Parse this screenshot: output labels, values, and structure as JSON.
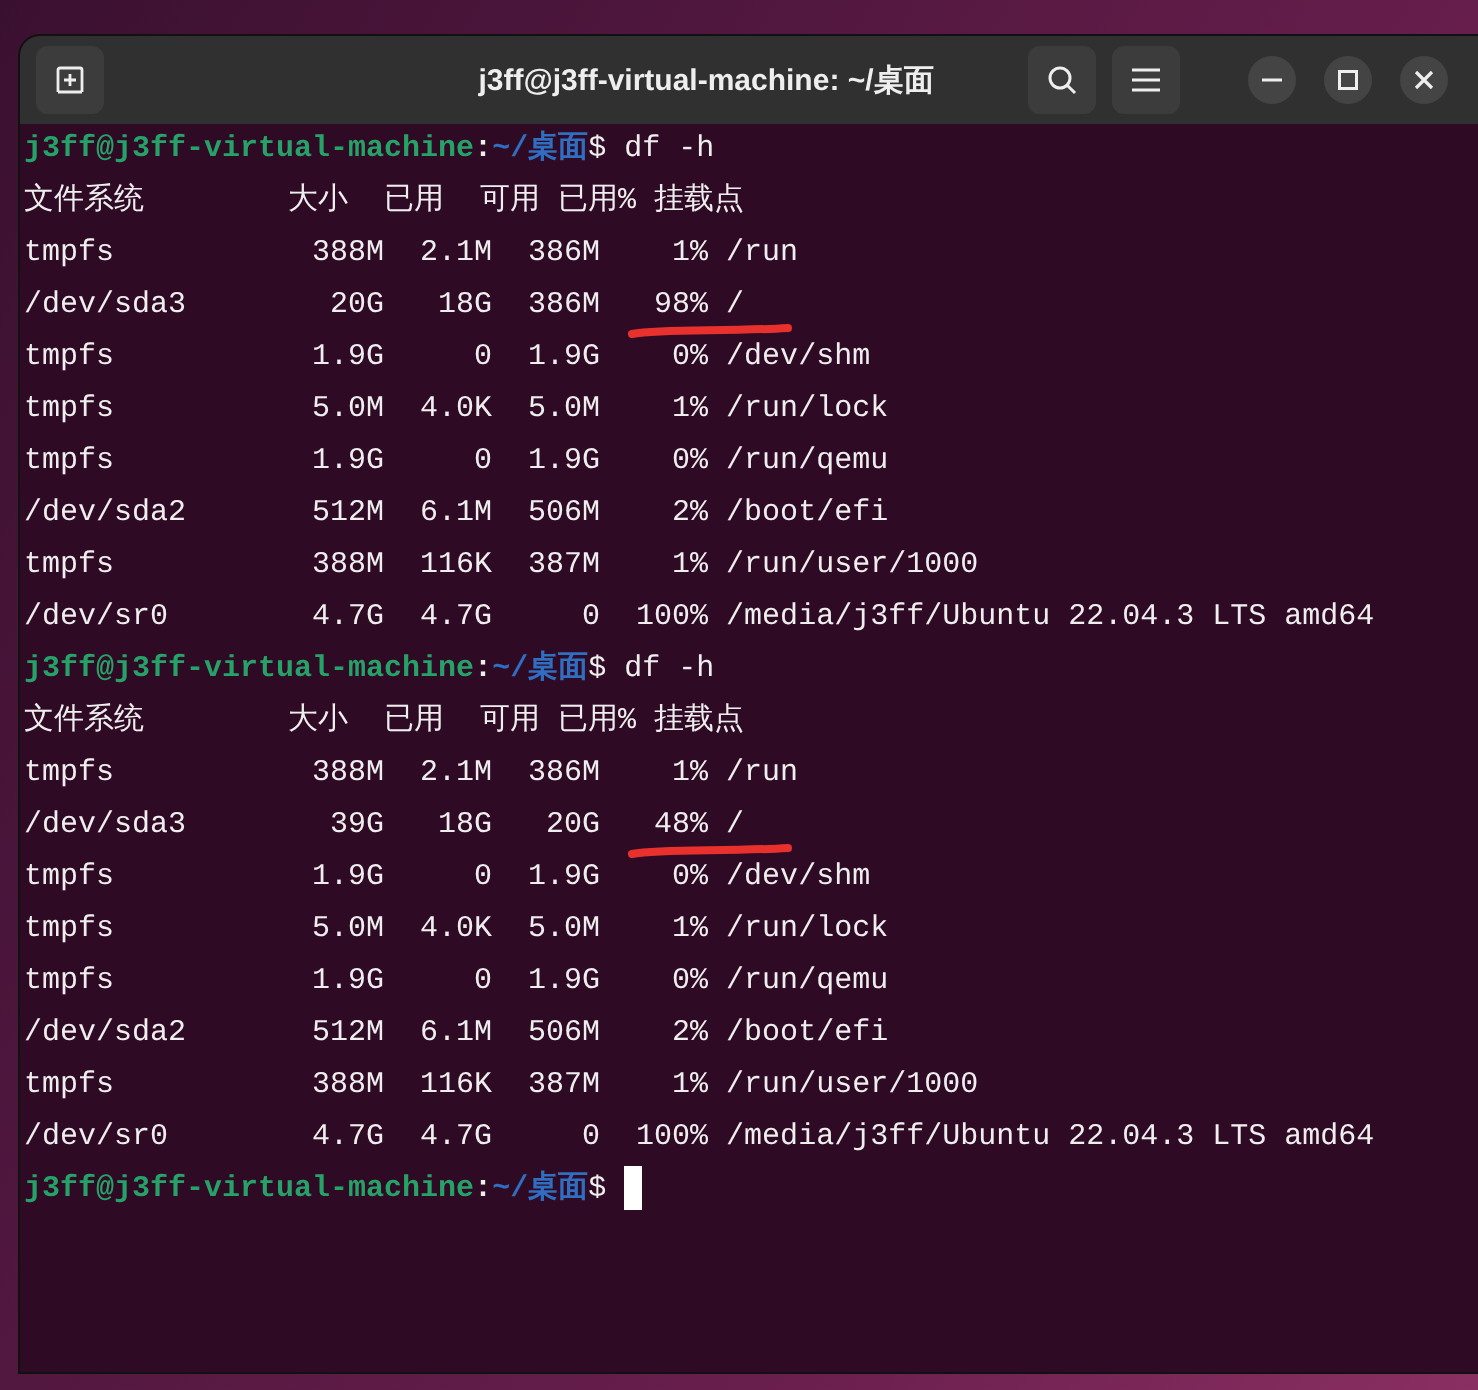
{
  "window": {
    "title": "j3ff@j3ff-virtual-machine: ~/桌面"
  },
  "terminal": {
    "lines": [
      {
        "kind": "prompt",
        "cursor": false,
        "segments": [
          {
            "kind": "user",
            "text": "j3ff@j3ff-virtual-machine"
          },
          {
            "kind": "sep",
            "text": ":"
          },
          {
            "kind": "path",
            "text": "~/桌面"
          },
          {
            "kind": "cmd",
            "text": "$ df -h"
          }
        ]
      },
      {
        "kind": "output",
        "underline": false,
        "text": "文件系统        大小  已用  可用 已用% 挂载点"
      },
      {
        "kind": "output",
        "underline": false,
        "text": "tmpfs           388M  2.1M  386M    1% /run"
      },
      {
        "kind": "output",
        "underline": true,
        "text": "/dev/sda3        20G   18G  386M   98% /"
      },
      {
        "kind": "output",
        "underline": false,
        "text": "tmpfs           1.9G     0  1.9G    0% /dev/shm"
      },
      {
        "kind": "output",
        "underline": false,
        "text": "tmpfs           5.0M  4.0K  5.0M    1% /run/lock"
      },
      {
        "kind": "output",
        "underline": false,
        "text": "tmpfs           1.9G     0  1.9G    0% /run/qemu"
      },
      {
        "kind": "output",
        "underline": false,
        "text": "/dev/sda2       512M  6.1M  506M    2% /boot/efi"
      },
      {
        "kind": "output",
        "underline": false,
        "text": "tmpfs           388M  116K  387M    1% /run/user/1000"
      },
      {
        "kind": "output",
        "underline": false,
        "text": "/dev/sr0        4.7G  4.7G     0  100% /media/j3ff/Ubuntu 22.04.3 LTS amd64"
      },
      {
        "kind": "prompt",
        "cursor": false,
        "segments": [
          {
            "kind": "user",
            "text": "j3ff@j3ff-virtual-machine"
          },
          {
            "kind": "sep",
            "text": ":"
          },
          {
            "kind": "path",
            "text": "~/桌面"
          },
          {
            "kind": "cmd",
            "text": "$ df -h"
          }
        ]
      },
      {
        "kind": "output",
        "underline": false,
        "text": "文件系统        大小  已用  可用 已用% 挂载点"
      },
      {
        "kind": "output",
        "underline": false,
        "text": "tmpfs           388M  2.1M  386M    1% /run"
      },
      {
        "kind": "output",
        "underline": true,
        "text": "/dev/sda3        39G   18G   20G   48% /"
      },
      {
        "kind": "output",
        "underline": false,
        "text": "tmpfs           1.9G     0  1.9G    0% /dev/shm"
      },
      {
        "kind": "output",
        "underline": false,
        "text": "tmpfs           5.0M  4.0K  5.0M    1% /run/lock"
      },
      {
        "kind": "output",
        "underline": false,
        "text": "tmpfs           1.9G     0  1.9G    0% /run/qemu"
      },
      {
        "kind": "output",
        "underline": false,
        "text": "/dev/sda2       512M  6.1M  506M    2% /boot/efi"
      },
      {
        "kind": "output",
        "underline": false,
        "text": "tmpfs           388M  116K  387M    1% /run/user/1000"
      },
      {
        "kind": "output",
        "underline": false,
        "text": "/dev/sr0        4.7G  4.7G     0  100% /media/j3ff/Ubuntu 22.04.3 LTS amd64"
      },
      {
        "kind": "prompt",
        "cursor": true,
        "segments": [
          {
            "kind": "user",
            "text": "j3ff@j3ff-virtual-machine"
          },
          {
            "kind": "sep",
            "text": ":"
          },
          {
            "kind": "path",
            "text": "~/桌面"
          },
          {
            "kind": "cmd",
            "text": "$ "
          }
        ]
      }
    ]
  }
}
